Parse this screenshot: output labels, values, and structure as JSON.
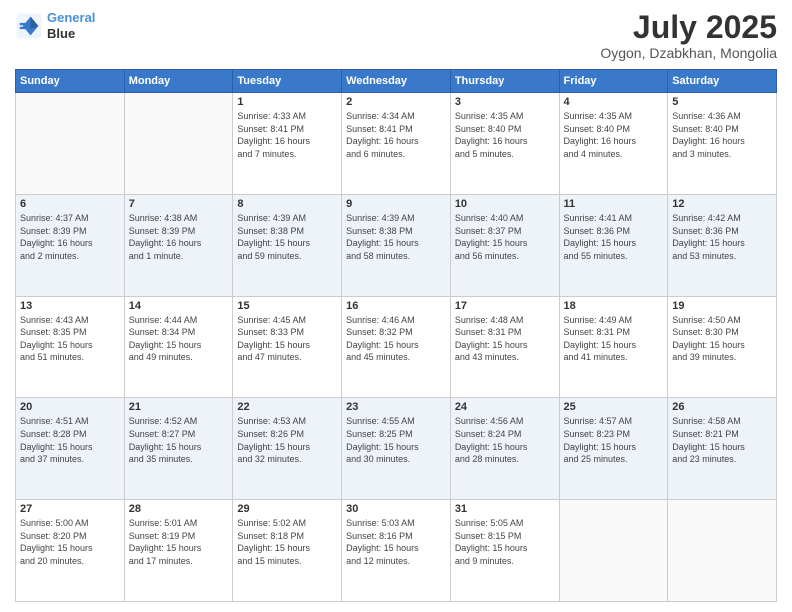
{
  "logo": {
    "line1": "General",
    "line2": "Blue"
  },
  "title": "July 2025",
  "location": "Oygon, Dzabkhan, Mongolia",
  "weekdays": [
    "Sunday",
    "Monday",
    "Tuesday",
    "Wednesday",
    "Thursday",
    "Friday",
    "Saturday"
  ],
  "weeks": [
    [
      {
        "day": "",
        "info": ""
      },
      {
        "day": "",
        "info": ""
      },
      {
        "day": "1",
        "info": "Sunrise: 4:33 AM\nSunset: 8:41 PM\nDaylight: 16 hours\nand 7 minutes."
      },
      {
        "day": "2",
        "info": "Sunrise: 4:34 AM\nSunset: 8:41 PM\nDaylight: 16 hours\nand 6 minutes."
      },
      {
        "day": "3",
        "info": "Sunrise: 4:35 AM\nSunset: 8:40 PM\nDaylight: 16 hours\nand 5 minutes."
      },
      {
        "day": "4",
        "info": "Sunrise: 4:35 AM\nSunset: 8:40 PM\nDaylight: 16 hours\nand 4 minutes."
      },
      {
        "day": "5",
        "info": "Sunrise: 4:36 AM\nSunset: 8:40 PM\nDaylight: 16 hours\nand 3 minutes."
      }
    ],
    [
      {
        "day": "6",
        "info": "Sunrise: 4:37 AM\nSunset: 8:39 PM\nDaylight: 16 hours\nand 2 minutes."
      },
      {
        "day": "7",
        "info": "Sunrise: 4:38 AM\nSunset: 8:39 PM\nDaylight: 16 hours\nand 1 minute."
      },
      {
        "day": "8",
        "info": "Sunrise: 4:39 AM\nSunset: 8:38 PM\nDaylight: 15 hours\nand 59 minutes."
      },
      {
        "day": "9",
        "info": "Sunrise: 4:39 AM\nSunset: 8:38 PM\nDaylight: 15 hours\nand 58 minutes."
      },
      {
        "day": "10",
        "info": "Sunrise: 4:40 AM\nSunset: 8:37 PM\nDaylight: 15 hours\nand 56 minutes."
      },
      {
        "day": "11",
        "info": "Sunrise: 4:41 AM\nSunset: 8:36 PM\nDaylight: 15 hours\nand 55 minutes."
      },
      {
        "day": "12",
        "info": "Sunrise: 4:42 AM\nSunset: 8:36 PM\nDaylight: 15 hours\nand 53 minutes."
      }
    ],
    [
      {
        "day": "13",
        "info": "Sunrise: 4:43 AM\nSunset: 8:35 PM\nDaylight: 15 hours\nand 51 minutes."
      },
      {
        "day": "14",
        "info": "Sunrise: 4:44 AM\nSunset: 8:34 PM\nDaylight: 15 hours\nand 49 minutes."
      },
      {
        "day": "15",
        "info": "Sunrise: 4:45 AM\nSunset: 8:33 PM\nDaylight: 15 hours\nand 47 minutes."
      },
      {
        "day": "16",
        "info": "Sunrise: 4:46 AM\nSunset: 8:32 PM\nDaylight: 15 hours\nand 45 minutes."
      },
      {
        "day": "17",
        "info": "Sunrise: 4:48 AM\nSunset: 8:31 PM\nDaylight: 15 hours\nand 43 minutes."
      },
      {
        "day": "18",
        "info": "Sunrise: 4:49 AM\nSunset: 8:31 PM\nDaylight: 15 hours\nand 41 minutes."
      },
      {
        "day": "19",
        "info": "Sunrise: 4:50 AM\nSunset: 8:30 PM\nDaylight: 15 hours\nand 39 minutes."
      }
    ],
    [
      {
        "day": "20",
        "info": "Sunrise: 4:51 AM\nSunset: 8:28 PM\nDaylight: 15 hours\nand 37 minutes."
      },
      {
        "day": "21",
        "info": "Sunrise: 4:52 AM\nSunset: 8:27 PM\nDaylight: 15 hours\nand 35 minutes."
      },
      {
        "day": "22",
        "info": "Sunrise: 4:53 AM\nSunset: 8:26 PM\nDaylight: 15 hours\nand 32 minutes."
      },
      {
        "day": "23",
        "info": "Sunrise: 4:55 AM\nSunset: 8:25 PM\nDaylight: 15 hours\nand 30 minutes."
      },
      {
        "day": "24",
        "info": "Sunrise: 4:56 AM\nSunset: 8:24 PM\nDaylight: 15 hours\nand 28 minutes."
      },
      {
        "day": "25",
        "info": "Sunrise: 4:57 AM\nSunset: 8:23 PM\nDaylight: 15 hours\nand 25 minutes."
      },
      {
        "day": "26",
        "info": "Sunrise: 4:58 AM\nSunset: 8:21 PM\nDaylight: 15 hours\nand 23 minutes."
      }
    ],
    [
      {
        "day": "27",
        "info": "Sunrise: 5:00 AM\nSunset: 8:20 PM\nDaylight: 15 hours\nand 20 minutes."
      },
      {
        "day": "28",
        "info": "Sunrise: 5:01 AM\nSunset: 8:19 PM\nDaylight: 15 hours\nand 17 minutes."
      },
      {
        "day": "29",
        "info": "Sunrise: 5:02 AM\nSunset: 8:18 PM\nDaylight: 15 hours\nand 15 minutes."
      },
      {
        "day": "30",
        "info": "Sunrise: 5:03 AM\nSunset: 8:16 PM\nDaylight: 15 hours\nand 12 minutes."
      },
      {
        "day": "31",
        "info": "Sunrise: 5:05 AM\nSunset: 8:15 PM\nDaylight: 15 hours\nand 9 minutes."
      },
      {
        "day": "",
        "info": ""
      },
      {
        "day": "",
        "info": ""
      }
    ]
  ]
}
